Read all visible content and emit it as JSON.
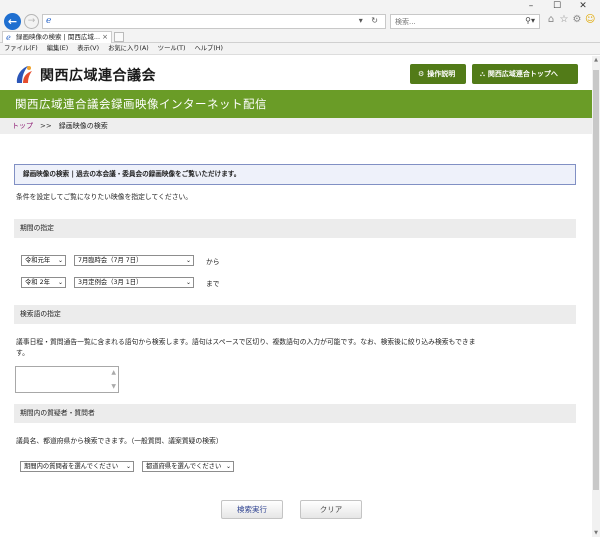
{
  "browser": {
    "window_controls": {
      "minimize": "–",
      "maximize": "☐",
      "close": "✕"
    },
    "nav": {
      "back": "←",
      "forward": "→"
    },
    "address_tools": "▾ ↻",
    "search_placeholder": "検索...",
    "search_icon": "⚲▾",
    "toolbar_icons": {
      "home": "⌂",
      "favorites": "☆",
      "settings": "⚙",
      "feedback": "☺"
    },
    "tab_title": "録画映像の検索 | 関西広域...",
    "tab_close": "×",
    "menu": [
      "ファイル(F)",
      "編集(E)",
      "表示(V)",
      "お気に入り(A)",
      "ツール(T)",
      "ヘルプ(H)"
    ]
  },
  "header": {
    "site_name": "関西広域連合議会",
    "manual_button": "操作説明",
    "manual_icon": "⚙",
    "top_button": "関西広域連合トップへ",
    "top_icon": "⛬",
    "brand_green": "#527b18"
  },
  "band": {
    "title": "関西広域連合議会録画映像インターネット配信",
    "color": "#6a9c27"
  },
  "breadcrumb": {
    "home": "トップ",
    "sep": ">>",
    "current": "録画映像の検索"
  },
  "main": {
    "info_box": "録画映像の検索 | 過去の本会議・委員会の録画映像をご覧いただけます。",
    "instruction": "条件を設定してご覧になりたい映像を指定してください。",
    "period": {
      "heading": "期間の指定",
      "from_era": "令和元年",
      "from_session": "7月臨時会（7月 7日）",
      "from_suffix": "から",
      "to_era": "令和 2年",
      "to_session": "3月定例会（3月 1日）",
      "to_suffix": "まで"
    },
    "keyword": {
      "heading": "検索語の指定",
      "desc_line1": "議事日程・質問通告一覧に含まれる語句から検索します。語句はスペースで区切り、複数語句の入力が可能です。なお、検索後に絞り込み検索もできま",
      "desc_line2": "す。",
      "textarea_value": ""
    },
    "speaker": {
      "heading": "期間内の質疑者・質問者",
      "desc": "議員名、都道府県から検索できます。（一般質問、議案質疑の検索）",
      "speaker_select": "期間内の質問者を選んでください",
      "pref_select": "都道府県を選んでください"
    },
    "buttons": {
      "search": "検索実行",
      "clear": "クリア"
    }
  }
}
